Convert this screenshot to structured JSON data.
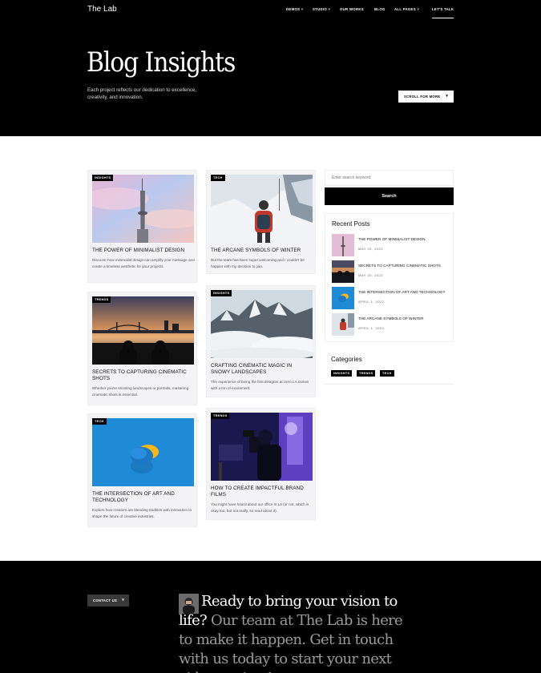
{
  "header": {
    "logo": "The Lab",
    "nav": [
      "DEMOS ˅",
      "STUDIO ˅",
      "OUR WORKS",
      "BLOG",
      "ALL PAGES ˅",
      "LET'S TALK"
    ]
  },
  "hero": {
    "title": "Blog Insights",
    "subtitle": "Each project reflects our dedication to excellence, creativity, and innovation.",
    "scroll_label": "SCROLL FOR MORE",
    "scroll_icon": "chevron-down-icon"
  },
  "posts": [
    {
      "tag": "INSIGHTS",
      "title": "THE POWER OF MINIMALIST DESIGN",
      "desc": "Discover how minimalist design can amplify your message and create a timeless aesthetic for your projects."
    },
    {
      "tag": "TECH",
      "title": "THE ARCANE SYMBOLS OF WINTER",
      "desc": "But the team has been super welcoming and I couldn't be happier with my decision to join."
    },
    {
      "tag": "TRENDS",
      "title": "SECRETS TO CAPTURING CINEMATIC SHOTS",
      "desc": "Whether you're shooting landscapes or portraits, mastering cinematic shots is essential."
    },
    {
      "tag": "INSIGHTS",
      "title": "CRAFTING CINEMATIC MAGIC IN SNOWY LANDSCAPES",
      "desc": "The experience of being the first designer at Uero LA comes with a ton of excitement."
    },
    {
      "tag": "TECH",
      "title": "THE INTERSECTION OF ART AND TECHNOLOGY",
      "desc": "Explore how creators are blending tradition with innovation to shape the future of creative industries."
    },
    {
      "tag": "TRENDS",
      "title": "HOW TO CREATE IMPACTFUL BRAND FILMS",
      "desc": "You might have heard about our office in LA (or not, which is okay too, but not really, so read about it)."
    }
  ],
  "sidebar": {
    "search_placeholder": "Enter search keyword",
    "search_button": "Search",
    "recent_title": "Recent Posts",
    "recent": [
      {
        "title": "THE POWER OF MINIMALIST DESIGN",
        "date": "MAY 20, 2022"
      },
      {
        "title": "SECRETS TO CAPTURING CINEMATIC SHOTS",
        "date": "MAY 20, 2022"
      },
      {
        "title": "THE INTERSECTION OF ART AND TECHNOLOGY",
        "date": "APRIL 1, 2022"
      },
      {
        "title": "THE ARCANE SYMBOLS OF WINTER",
        "date": "APRIL 1, 2022"
      }
    ],
    "categories_title": "Categories",
    "categories": [
      "INSIGHTS",
      "TRENDS",
      "TECH"
    ]
  },
  "footer": {
    "contact_label": "CONTACT US",
    "contact_icon": "chevron-down-icon",
    "cta_lead": "Ready to bring your vision to life?",
    "cta_rest": "Our team at The Lab is here to make it happen. Get in touch with us today to start your next video project!"
  }
}
